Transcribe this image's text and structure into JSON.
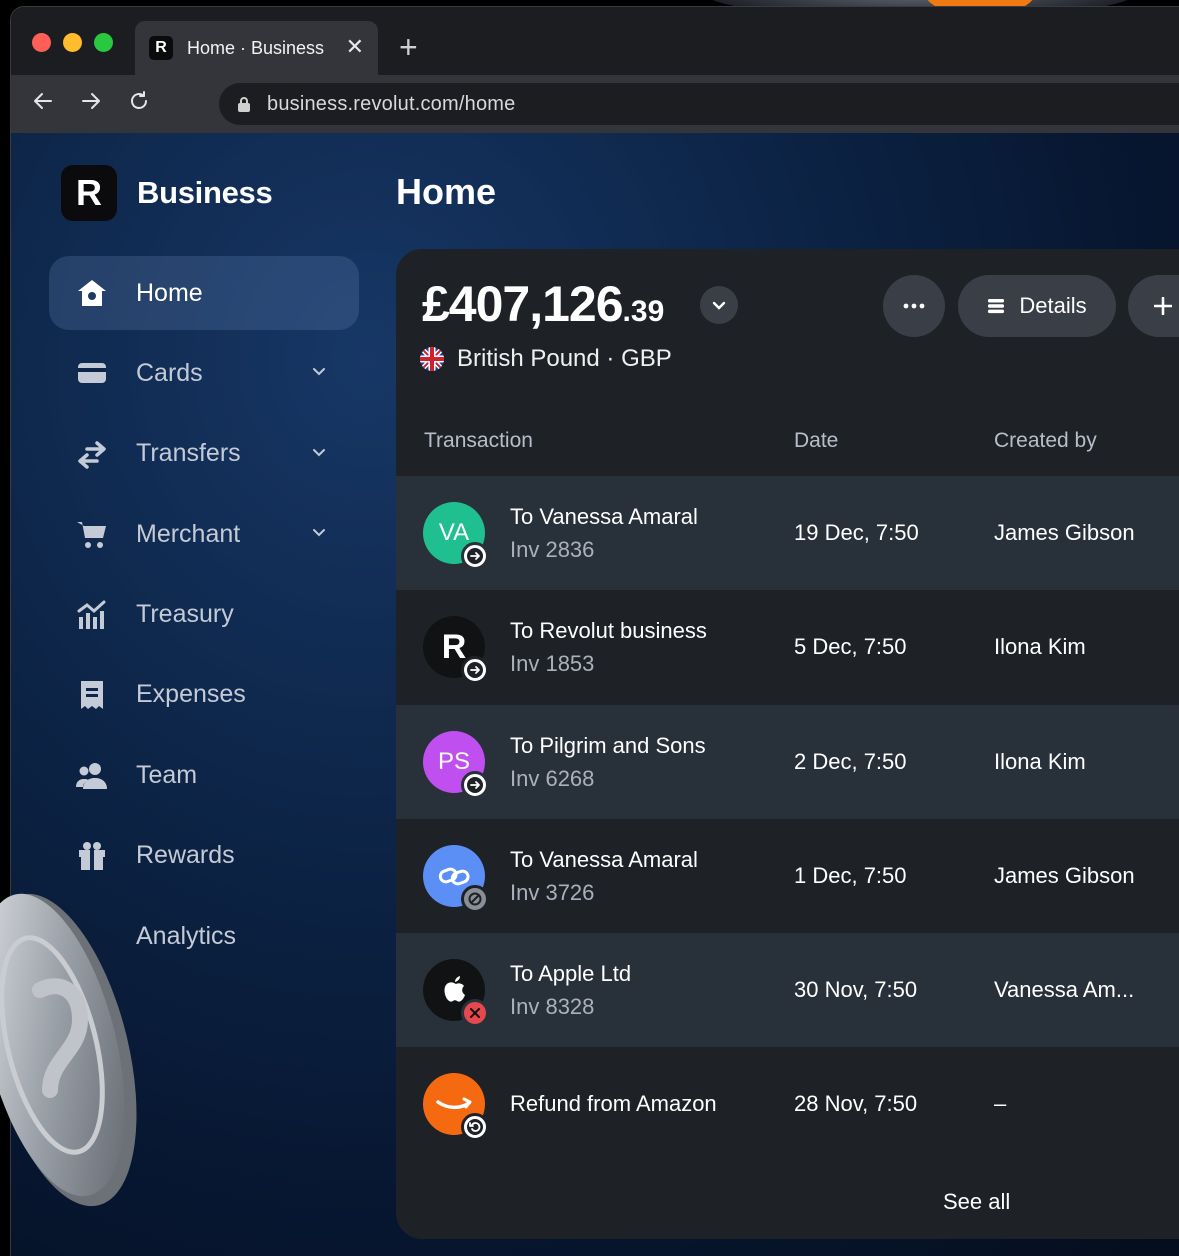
{
  "browser": {
    "tab_title": "Home · Business",
    "tab_favicon": "R",
    "url": "business.revolut.com/home",
    "colors": {
      "red": "#ff5f57",
      "yellow": "#febc2e",
      "green": "#28c840"
    }
  },
  "brand": {
    "logo": "R",
    "name": "Business"
  },
  "page_title": "Home",
  "sidebar": {
    "items": [
      {
        "label": "Home",
        "icon": "home-icon",
        "active": true
      },
      {
        "label": "Cards",
        "icon": "card-icon",
        "chevron": true
      },
      {
        "label": "Transfers",
        "icon": "transfers-icon",
        "chevron": true
      },
      {
        "label": "Merchant",
        "icon": "cart-icon",
        "chevron": true
      },
      {
        "label": "Treasury",
        "icon": "chart-bars-icon"
      },
      {
        "label": "Expenses",
        "icon": "receipt-icon"
      },
      {
        "label": "Team",
        "icon": "team-icon"
      },
      {
        "label": "Rewards",
        "icon": "gift-icon"
      },
      {
        "label": "Analytics",
        "icon": "analytics-icon"
      }
    ]
  },
  "balance": {
    "main": "£407,126",
    "decimal": ".39",
    "currency_label": "British Pound · GBP",
    "details_label": "Details"
  },
  "table": {
    "headers": {
      "transaction": "Transaction",
      "date": "Date",
      "created_by": "Created by"
    },
    "rows": [
      {
        "initials": "VA",
        "avatar_color": "#1fbf8f",
        "name": "To Vanessa Amaral",
        "sub": "Inv 2836",
        "date": "19 Dec, 7:50",
        "created_by": "James Gibson",
        "badge": "arrow"
      },
      {
        "initials": "R",
        "avatar_color": "#111214",
        "name": "To Revolut business",
        "sub": "Inv 1853",
        "date": "5 Dec, 7:50",
        "created_by": "Ilona Kim",
        "badge": "arrow"
      },
      {
        "initials": "PS",
        "avatar_color": "#c04ff0",
        "name": "To Pilgrim and Sons",
        "sub": "Inv 6268",
        "date": "2 Dec, 7:50",
        "created_by": "Ilona Kim",
        "badge": "arrow"
      },
      {
        "initials": "",
        "avatar_color": "#5b8ff5",
        "name": "To Vanessa Amaral",
        "sub": "Inv 3726",
        "date": "1 Dec, 7:50",
        "created_by": "James Gibson",
        "badge": "blocked"
      },
      {
        "initials": "",
        "avatar_color": "#111214",
        "name": "To Apple Ltd",
        "sub": "Inv 8328",
        "date": "30 Nov, 7:50",
        "created_by": "Vanessa Am...",
        "badge": "failed"
      },
      {
        "initials": "",
        "avatar_color": "#f56a11",
        "name": "Refund from Amazon",
        "sub": "",
        "date": "28 Nov, 7:50",
        "created_by": "–",
        "badge": "refund"
      }
    ],
    "see_all": "See all"
  }
}
